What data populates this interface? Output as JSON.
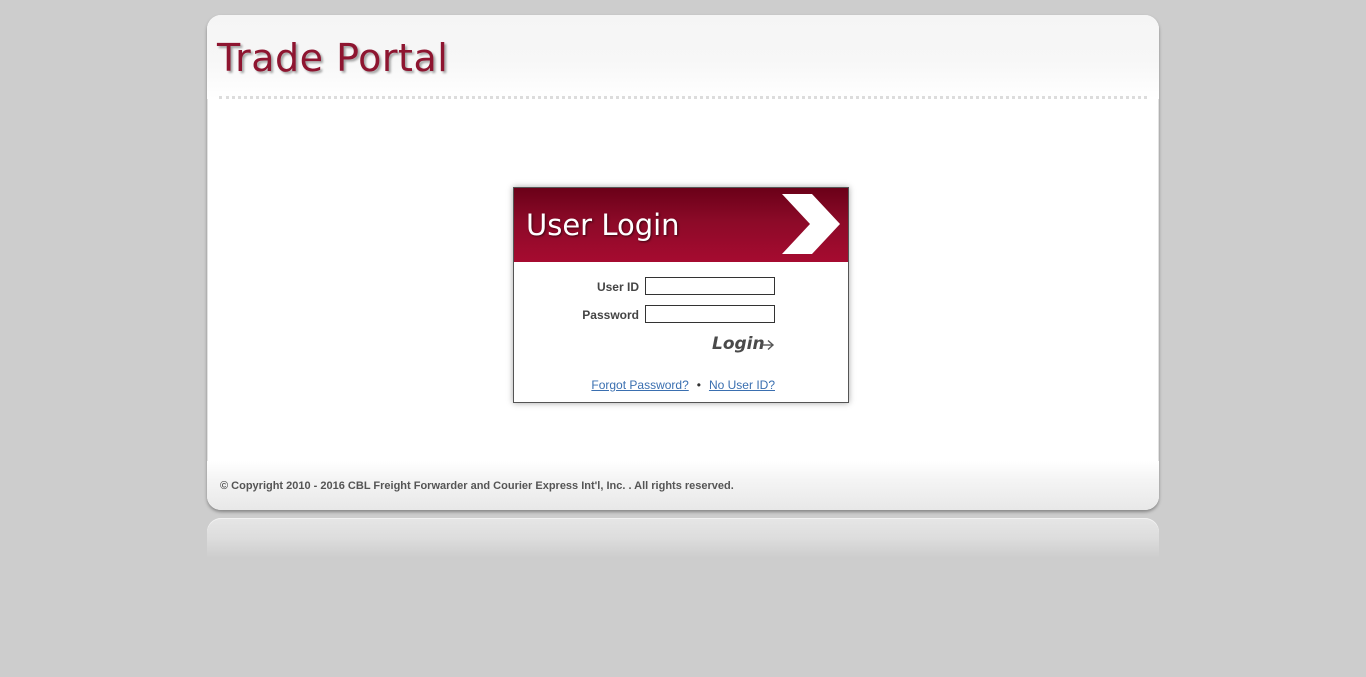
{
  "site": {
    "title": "Trade Portal"
  },
  "login": {
    "title": "User Login",
    "user_id_label": "User ID",
    "user_id_value": "",
    "password_label": "Password",
    "password_value": "",
    "button_label": "Login",
    "forgot_password_link": "Forgot Password?",
    "separator": "•",
    "no_user_id_link": "No User ID?"
  },
  "footer": {
    "copyright": "© Copyright 2010 - 2016 CBL Freight Forwarder and Courier Express Int'l, Inc. . All rights reserved."
  },
  "colors": {
    "page_background": "#cdcdcd",
    "brand_red": "#8e1530",
    "header_dark_red": "#6a0018",
    "link_blue": "#3a6fb0"
  },
  "icons": {
    "header_chevron": "chevron-right-icon",
    "login_arrow": "arrow-right-icon"
  }
}
